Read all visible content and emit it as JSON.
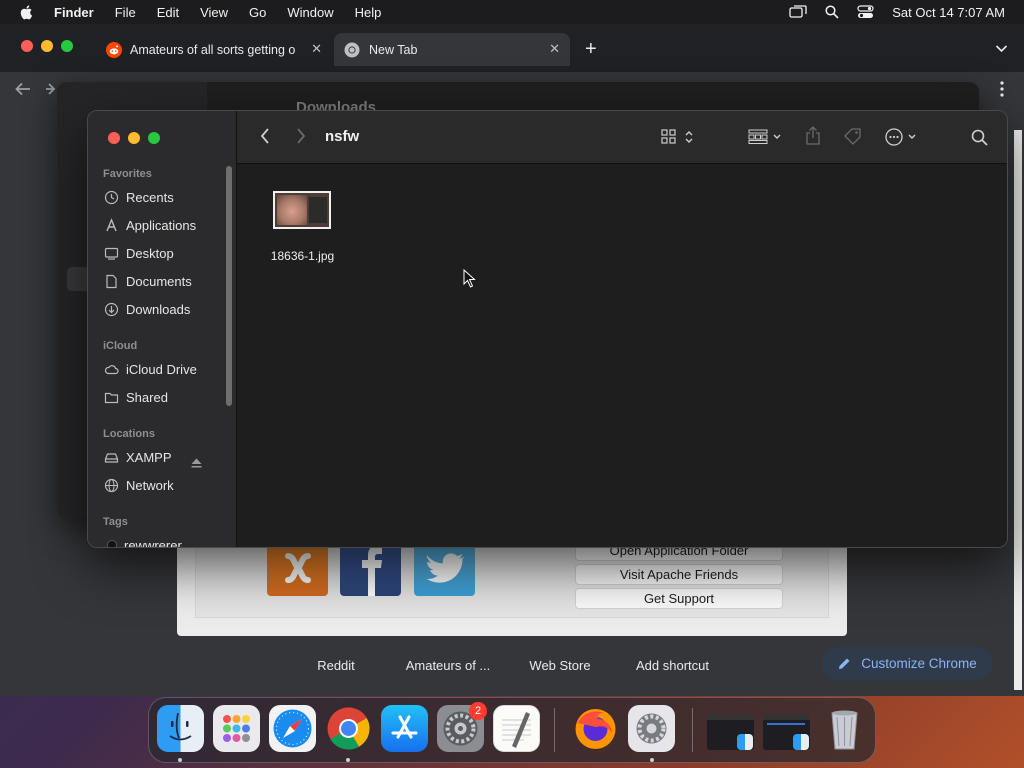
{
  "menubar": {
    "app_name": "Finder",
    "items": [
      "File",
      "Edit",
      "View",
      "Go",
      "Window",
      "Help"
    ],
    "clock": "Sat Oct 14  7:07 AM"
  },
  "chrome": {
    "tabs": [
      {
        "title": "Amateurs of all sorts getting o",
        "icon": "reddit-icon"
      },
      {
        "title": "New Tab",
        "icon": "chrome-icon"
      }
    ],
    "shortcuts": [
      "Reddit",
      "Amateurs of ...",
      "Web Store",
      "Add shortcut"
    ],
    "customize_label": "Customize Chrome"
  },
  "xampp": {
    "buttons": [
      "Open Application Folder",
      "Visit Apache Friends",
      "Get Support"
    ]
  },
  "background_finder": {
    "title": "Downloads"
  },
  "finder": {
    "folder_title": "nsfw",
    "sidebar": {
      "favorites_header": "Favorites",
      "favorites": [
        "Recents",
        "Applications",
        "Desktop",
        "Documents",
        "Downloads"
      ],
      "icloud_header": "iCloud",
      "icloud": [
        "iCloud Drive",
        "Shared"
      ],
      "locations_header": "Locations",
      "locations": [
        "XAMPP",
        "Network"
      ],
      "tags_header": "Tags",
      "tags": [
        "rewwrerer"
      ]
    },
    "files": [
      {
        "name": "18636-1.jpg"
      }
    ]
  },
  "dock": {
    "apps": [
      "Finder",
      "Launchpad",
      "Safari",
      "Google Chrome",
      "App Store",
      "System Settings",
      "TextEdit",
      "Firefox",
      "System Preferences",
      "Window 1",
      "Window 2",
      "Trash"
    ],
    "settings_badge": "2"
  },
  "colors": {
    "accent_blue": "#8ab4f8",
    "traffic_red": "#ff5f57",
    "traffic_yellow": "#febc2e",
    "traffic_green": "#28c840"
  }
}
